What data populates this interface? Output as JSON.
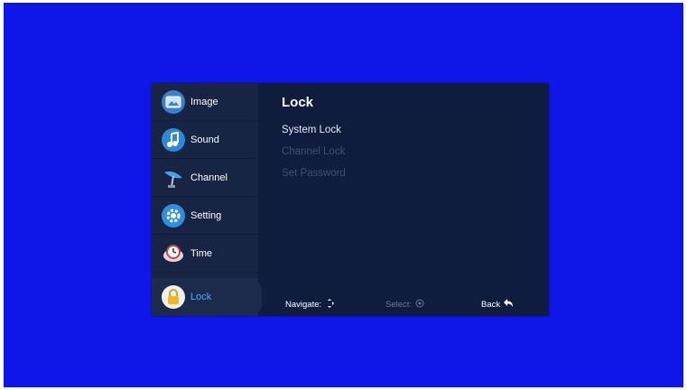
{
  "sidebar": {
    "items": [
      {
        "label": "Image",
        "icon": "image-icon",
        "active": false
      },
      {
        "label": "Sound",
        "icon": "music-note-icon",
        "active": false
      },
      {
        "label": "Channel",
        "icon": "satellite-dish-icon",
        "active": false
      },
      {
        "label": "Setting",
        "icon": "gear-icon",
        "active": false
      },
      {
        "label": "Time",
        "icon": "clock-icon",
        "active": false
      },
      {
        "label": "Lock",
        "icon": "padlock-icon",
        "active": true
      }
    ]
  },
  "panel": {
    "title": "Lock",
    "options": [
      {
        "label": "System Lock",
        "enabled": true
      },
      {
        "label": "Channel Lock",
        "enabled": false
      },
      {
        "label": "Set Password",
        "enabled": false
      }
    ]
  },
  "footer": {
    "navigate_label": "Navigate:",
    "select_label": "Select:",
    "back_label": "Back"
  },
  "colors": {
    "background": "#0f16e8",
    "menu_panel": "#0f1c3e",
    "sidebar": "#182443",
    "active_label": "#4fa8ff",
    "disabled_text": "#44506b"
  }
}
